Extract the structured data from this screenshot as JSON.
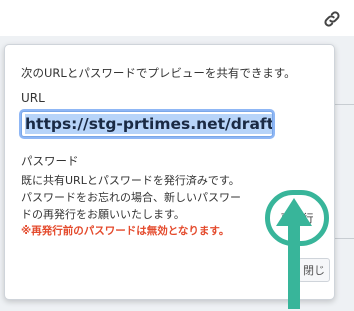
{
  "popover": {
    "intro": "次のURLとパスワードでプレビューを共有できます。",
    "url_label": "URL",
    "url_value": "https://stg-prtimes.net/draft/",
    "password_label": "パスワード",
    "password_lines": [
      "既に共有URLとパスワードを発行済みです。",
      "パスワードをお忘れの場合、新しいパスワー",
      "ドの再発行をお願いいたします。"
    ],
    "password_warning": "※再発行前のパスワードは無効となります。",
    "reissue_label": "再発行",
    "close_label": "閉じる"
  },
  "icons": {
    "top_right": "link-icon",
    "annotation": "arrow-up-icon"
  },
  "colors": {
    "highlight": "#38b59a",
    "warning": "#e44a2c",
    "selection": "#b7d4f9"
  }
}
